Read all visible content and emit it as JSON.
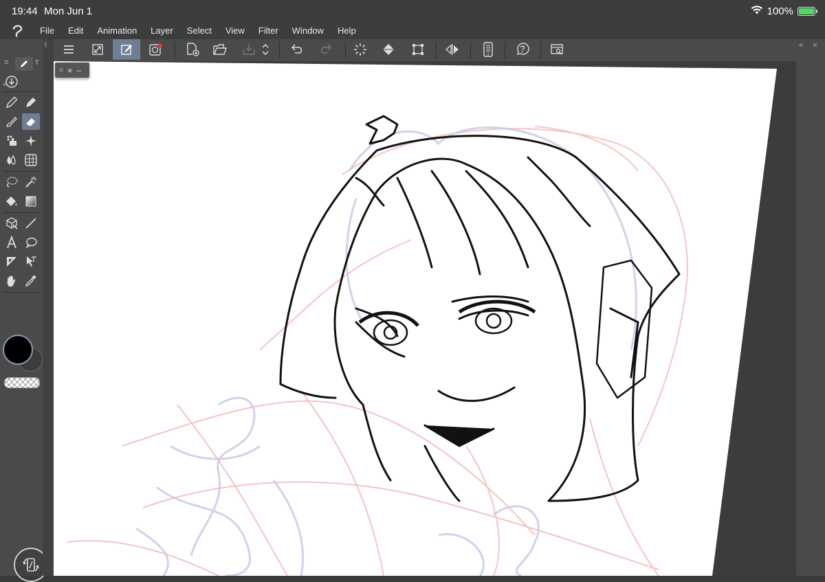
{
  "status": {
    "time": "19:44",
    "date": "Mon Jun 1",
    "battery_percent": "100%",
    "battery_level": 1.0
  },
  "menu": [
    "File",
    "Edit",
    "Animation",
    "Layer",
    "Select",
    "View",
    "Filter",
    "Window",
    "Help"
  ],
  "toolbar": {
    "buttons": [
      "menu-icon",
      "expand-canvas-icon",
      "edit-canvas-icon",
      "companion-mode-icon",
      "new-file-icon",
      "open-file-icon",
      "save-icon",
      "up-down-icon",
      "undo-icon",
      "redo-icon",
      "loading-icon",
      "fill-icon",
      "transform-icon",
      "flip-icon",
      "smartphone-icon",
      "help-icon",
      "settings-icon"
    ],
    "active": "edit-canvas-icon"
  },
  "tools": {
    "active": "eraser-tool"
  },
  "colors": {
    "main": "#000000",
    "sub": "#3c3c3c",
    "accent": "#6f7d95",
    "canvas": "#ffffff"
  },
  "mini_panel": {
    "close": "×",
    "minimize": "–"
  }
}
